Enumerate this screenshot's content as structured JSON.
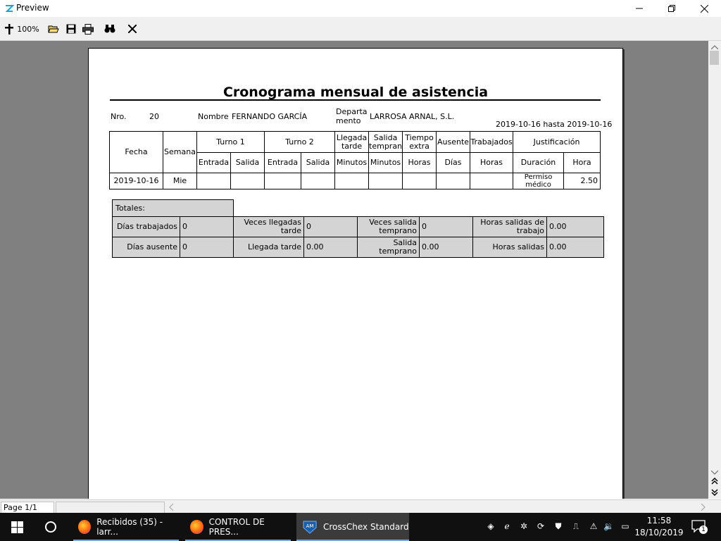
{
  "window": {
    "title": "Preview",
    "zoom": "100%"
  },
  "report": {
    "title": "Cronograma mensual de asistencia",
    "nro_label": "Nro.",
    "nro_value": "20",
    "nombre_label": "Nombre",
    "nombre_value": "FERNANDO GARCÍA",
    "departamento_label_1": "Departa",
    "departamento_label_2": "mento",
    "departamento_value": "LARROSA ARNAL, S.L.",
    "date_range": "2019-10-16 hasta 2019-10-16",
    "headers": {
      "fecha": "Fecha",
      "semana": "Semana",
      "turno1": "Turno 1",
      "turno2": "Turno 2",
      "llegada_tarde": "Llegada tarde",
      "salida_temprano": "Salida temprano",
      "tiempo_extra": "Tiempo extra",
      "ausente": "Ausente",
      "trabajados": "Trabajados",
      "justificacion": "Justificación",
      "entrada1": "Entrada",
      "salida1": "Salida",
      "entrada2": "Entrada",
      "salida2": "Salida",
      "minutos1": "Minutos",
      "minutos2": "Minutos",
      "horas1": "Horas",
      "dias": "Días",
      "horas2": "Horas",
      "duracion": "Duración",
      "hora": "Hora"
    },
    "rows": [
      {
        "fecha": "2019-10-16",
        "semana": "Mie",
        "duracion": "Permiso médico",
        "hora": "2.50"
      }
    ],
    "totals": {
      "label": "Totales:",
      "dias_trabajados_label": "Días trabajados",
      "dias_trabajados_value": "0",
      "veces_llegadas_tarde_label": "Veces llegadas tarde",
      "veces_llegadas_tarde_value": "0",
      "veces_salida_temprano_label": "Veces salida temprano",
      "veces_salida_temprano_value": "0",
      "horas_salidas_trabajo_label": "Horas salidas de trabajo",
      "horas_salidas_trabajo_value": "0.00",
      "dias_ausente_label": "Días ausente",
      "dias_ausente_value": "0",
      "llegada_tarde_label": "Llegada tarde",
      "llegada_tarde_value": "0.00",
      "salida_temprano_label": "Salida temprano",
      "salida_temprano_value": "0.00",
      "horas_salidas_label": "Horas salidas",
      "horas_salidas_value": "0.00"
    }
  },
  "statusbar": {
    "page": "Page 1/1"
  },
  "taskbar": {
    "items": [
      {
        "label": "Recibidos (35) - larr..."
      },
      {
        "label": "CONTROL DE PRES..."
      },
      {
        "label": "CrossChex Standard"
      }
    ],
    "time": "11:58",
    "date": "18/10/2019",
    "notification_count": "1"
  },
  "colors": {
    "preview_background": "#808080",
    "totals_fill": "#d4d4d4",
    "taskbar": "#101010"
  }
}
